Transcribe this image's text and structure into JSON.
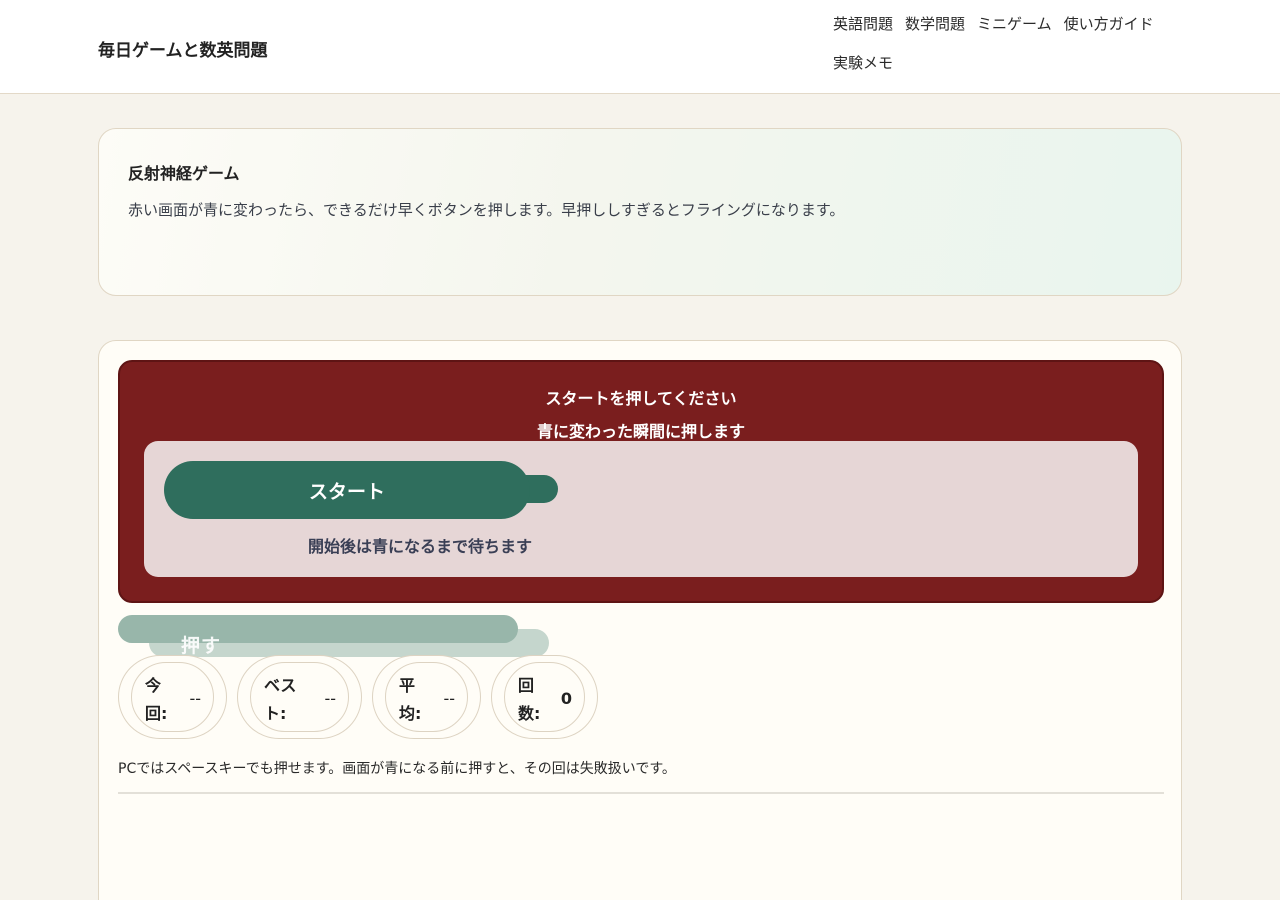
{
  "header": {
    "site_title": "毎日ゲームと数英問題",
    "nav": [
      "英語問題",
      "数学問題",
      "ミニゲーム",
      "使い方ガイド",
      "実験メモ"
    ]
  },
  "intro": {
    "title": "反射神経ゲーム",
    "text": "赤い画面が青に変わったら、できるだけ早くボタンを押します。早押ししすぎるとフライングになります。"
  },
  "game": {
    "screen_message_1": "スタートを押してください",
    "screen_message_2": "青に変わった瞬間に押します",
    "start_label": "スタート",
    "start_hint": "開始後は青になるまで待ちます",
    "push_label": "押す",
    "stats": [
      {
        "label": "今回:",
        "value": "--"
      },
      {
        "label": "ベスト:",
        "value": "--"
      },
      {
        "label": "平均:",
        "value": "--"
      },
      {
        "label": "回数:",
        "value": "0"
      }
    ],
    "footnote": "PCではスペースキーでも押せます。画面が青になる前に押すと、その回は失敗扱いです。"
  },
  "colors": {
    "screen_red": "#7a1e1e",
    "start_green": "#2f6e5d",
    "push_disabled": "#98b6aa",
    "background": "#f6f3ec"
  }
}
